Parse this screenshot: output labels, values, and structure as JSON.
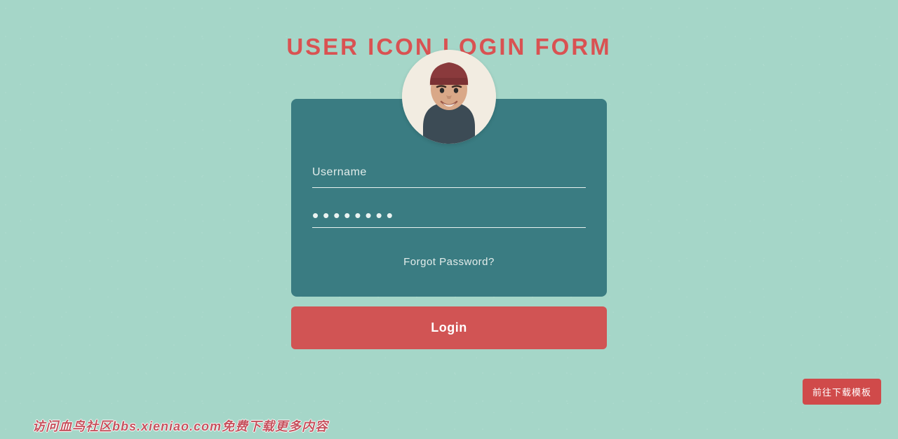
{
  "heading": {
    "title": "USER ICON LOGIN FORM"
  },
  "form": {
    "username_placeholder": "Username",
    "username_value": "",
    "password_value": "••••••••",
    "forgot_label": "Forgot Password?",
    "login_label": "Login"
  },
  "buttons": {
    "download_template": "前往下载模板"
  },
  "watermark": {
    "text": "访问血鸟社区bbs.xieniao.com免费下载更多内容"
  }
}
